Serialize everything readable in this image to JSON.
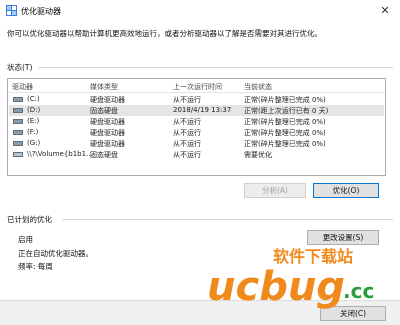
{
  "window": {
    "title": "优化驱动器",
    "close_glyph": "✕"
  },
  "intro_text": "你可以优化驱动器以帮助计算机更高效地运行，或者分析驱动器以了解是否需要对其进行优化。",
  "status_section": {
    "label": "状态(T)",
    "columns": [
      "驱动器",
      "媒体类型",
      "上一次运行时间",
      "当前状态"
    ],
    "rows": [
      {
        "drive": "(C:)",
        "media": "硬盘驱动器",
        "last_run": "从不运行",
        "status": "正常(碎片整理已完成 0%)",
        "icon": "hard-drive-icon",
        "selected": false
      },
      {
        "drive": "(D:)",
        "media": "固态硬盘",
        "last_run": "2018/4/19 13:37",
        "status": "正常(距上次运行已有 0 天)",
        "icon": "hard-drive-icon",
        "selected": true
      },
      {
        "drive": "(E:)",
        "media": "硬盘驱动器",
        "last_run": "从不运行",
        "status": "正常(碎片整理已完成 0%)",
        "icon": "hard-drive-icon",
        "selected": false
      },
      {
        "drive": "(F:)",
        "media": "硬盘驱动器",
        "last_run": "从不运行",
        "status": "正常(碎片整理已完成 0%)",
        "icon": "hard-drive-icon",
        "selected": false
      },
      {
        "drive": "(G:)",
        "media": "硬盘驱动器",
        "last_run": "从不运行",
        "status": "正常(碎片整理已完成 0%)",
        "icon": "hard-drive-icon",
        "selected": false
      },
      {
        "drive": "\\\\?\\Volume{b1b1...",
        "media": "固态硬盘",
        "last_run": "从不运行",
        "status": "需要优化",
        "icon": "removable-drive-icon",
        "selected": false
      }
    ],
    "analyze_button": "分析(A)",
    "optimize_button": "优化(O)"
  },
  "schedule_section": {
    "label": "已计划的优化",
    "state": "启用",
    "line1": "正在自动优化驱动器。",
    "line2": "频率: 每周",
    "change_settings_button": "更改设置(S)"
  },
  "footer": {
    "close_button": "关闭(C)"
  },
  "watermark": {
    "text_top": "软件下载站",
    "text_main": "ucbug",
    "text_suffix": ".cc"
  },
  "colors": {
    "accent": "#0078d7",
    "selected_row": "#e5e5e5",
    "watermark_orange": "#f08a1c",
    "watermark_green": "#2a9e3a"
  }
}
